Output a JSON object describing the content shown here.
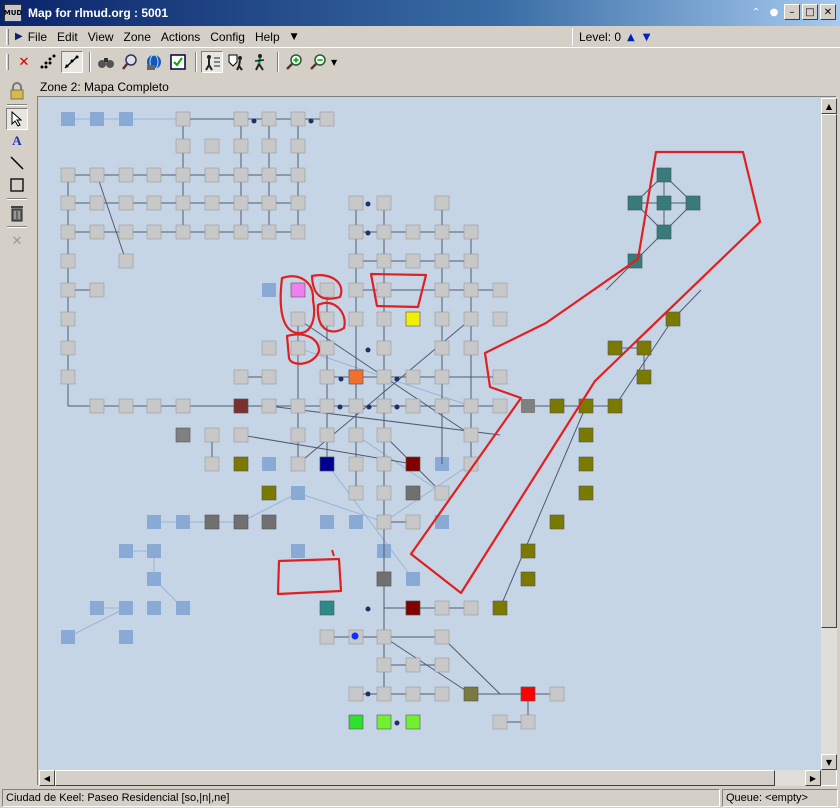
{
  "window": {
    "title": "Map for rlmud.org : 5001",
    "app_icon_text": "MUD"
  },
  "menu": {
    "items": [
      "File",
      "Edit",
      "View",
      "Zone",
      "Actions",
      "Config",
      "Help"
    ],
    "level_label": "Level: 0"
  },
  "toolbar": {
    "tools": [
      "delete-icon",
      "connect-icon",
      "auto-connect-icon",
      "binoculars-icon",
      "find-icon",
      "speedwalk-icon",
      "checkbox-icon",
      "path-icon",
      "walker-shield-icon",
      "walker-icon",
      "zoom-in-icon",
      "zoom-out-icon"
    ]
  },
  "left_tools": [
    "lock-icon",
    "select-arrow-icon",
    "text-icon",
    "line-icon",
    "rectangle-icon",
    "trash-icon",
    "close-icon"
  ],
  "zone": {
    "label": "Zone 2: Mapa Completo"
  },
  "status": {
    "location": "Ciudad de Keel: Paseo Residencial [so,|n|,ne]",
    "queue": "Queue: <empty>"
  },
  "colors": {
    "room_default": "#c8c8c8",
    "room_faded": "#8aaad6",
    "map_background": "#c6d5e6",
    "olive": "#7a7a00",
    "teal": "#3a7a7a",
    "annotation_red": "#e02020"
  }
}
